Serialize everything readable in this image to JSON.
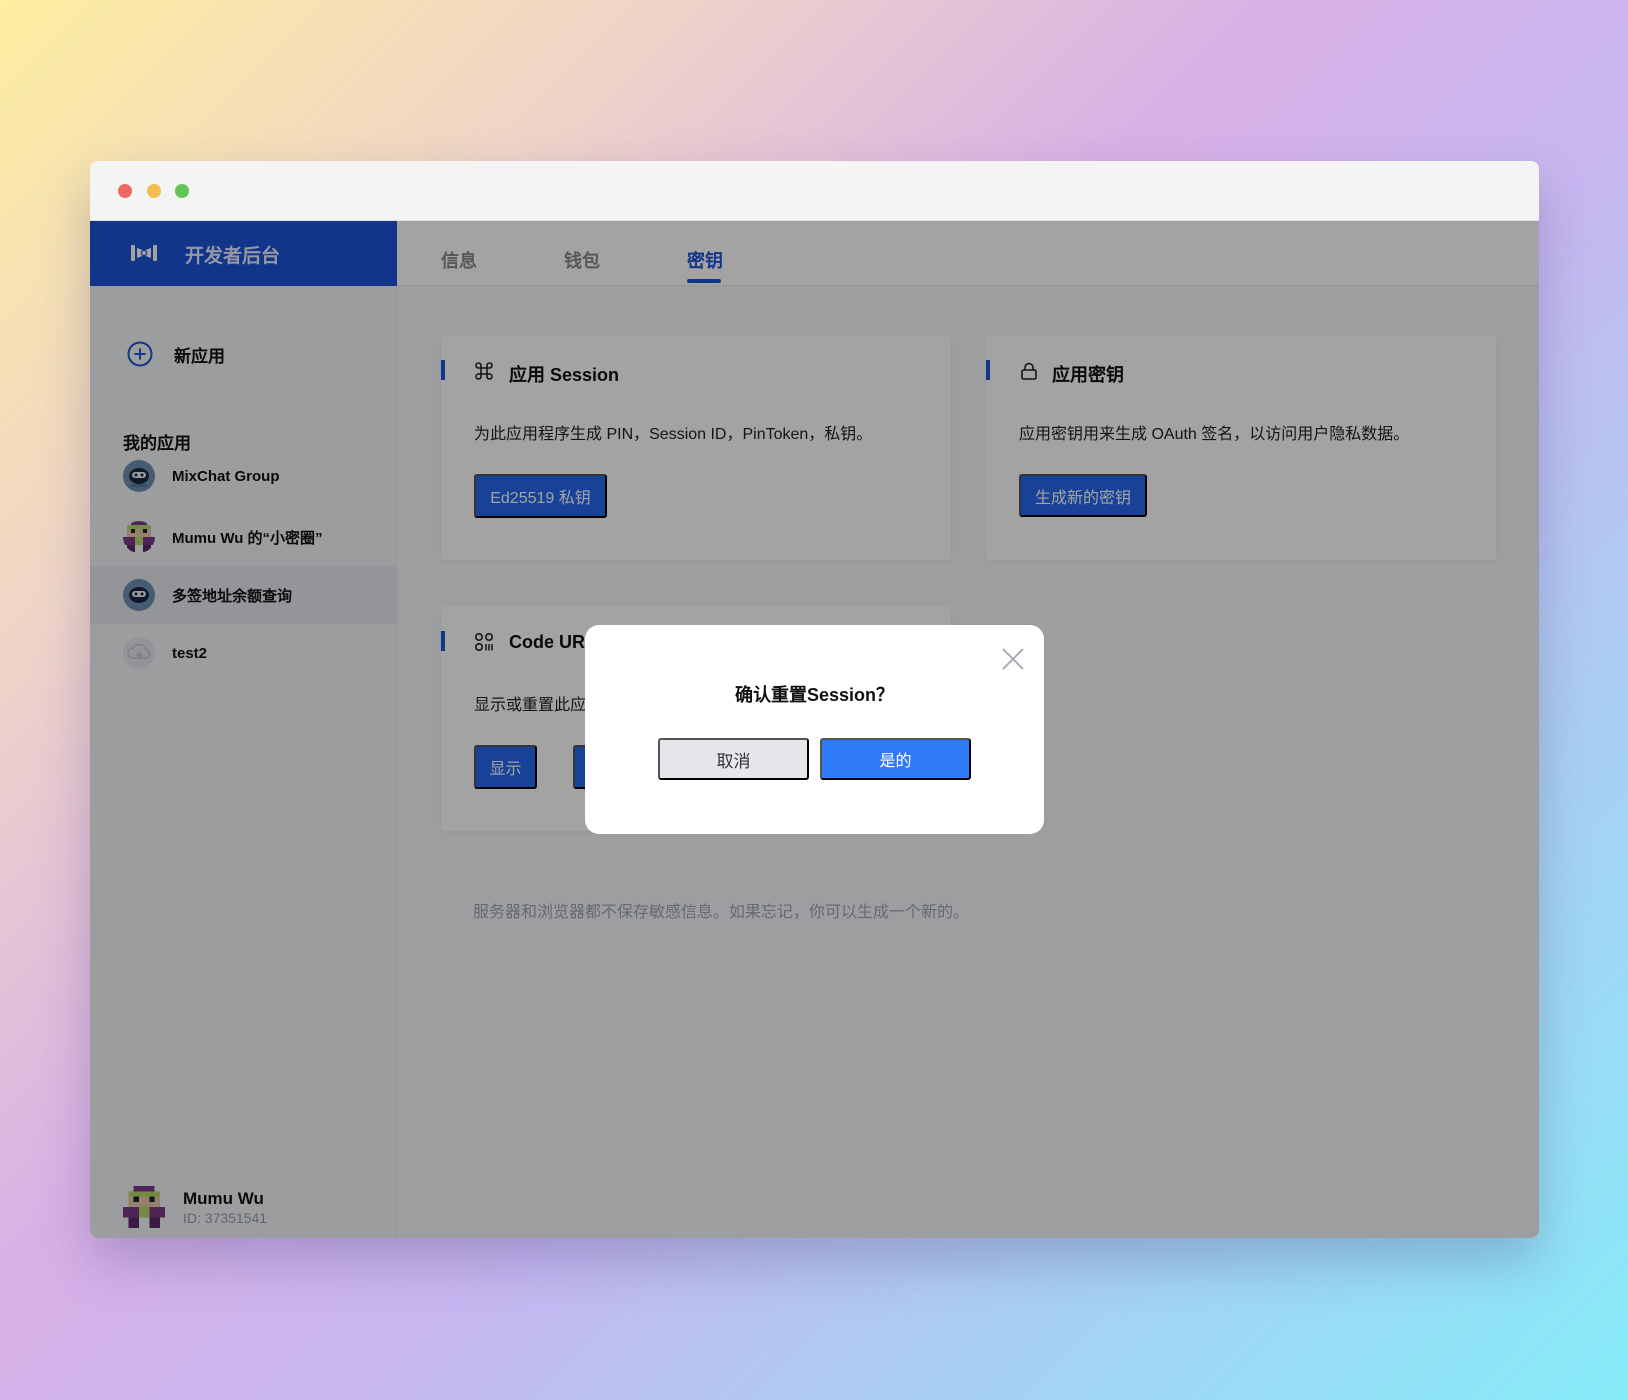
{
  "window": {
    "controls": [
      "close",
      "minimize",
      "maximize"
    ]
  },
  "sidebar": {
    "brand_icon": "mixin-logo-icon",
    "brand_title": "开发者后台",
    "new_app_label": "新应用",
    "section_title": "我的应用",
    "apps": [
      {
        "name": "MixChat Group",
        "avatar": "robot-avatar"
      },
      {
        "name": "Mumu Wu 的“小密圈”",
        "avatar": "pixel-avatar"
      },
      {
        "name": "多签地址余额查询",
        "avatar": "robot-avatar",
        "active": true
      },
      {
        "name": "test2",
        "avatar": "cloud-avatar"
      }
    ],
    "user": {
      "name": "Mumu Wu",
      "id": "ID: 37351541"
    }
  },
  "tabs": [
    {
      "label": "信息"
    },
    {
      "label": "钱包"
    },
    {
      "label": "密钥",
      "active": true
    }
  ],
  "cards": {
    "session": {
      "title": "应用 Session",
      "description": "为此应用程序生成 PIN，Session ID，PinToken，私钥。",
      "button": "Ed25519 私钥"
    },
    "secret": {
      "title": "应用密钥",
      "description": "应用密钥用来生成 OAuth 签名，以访问用户隐私数据。",
      "button": "生成新的密钥"
    },
    "code_url": {
      "title": "Code UR",
      "description": "显示或重置此应",
      "button_show": "显示"
    }
  },
  "footnote": "服务器和浏览器都不保存敏感信息。如果忘记，你可以生成一个新的。",
  "modal": {
    "title": "确认重置Session？",
    "cancel": "取消",
    "confirm": "是的"
  },
  "colors": {
    "brand": "#1d54d6",
    "primary_button": "#2766ee",
    "modal_confirm": "#2f7bf7"
  }
}
